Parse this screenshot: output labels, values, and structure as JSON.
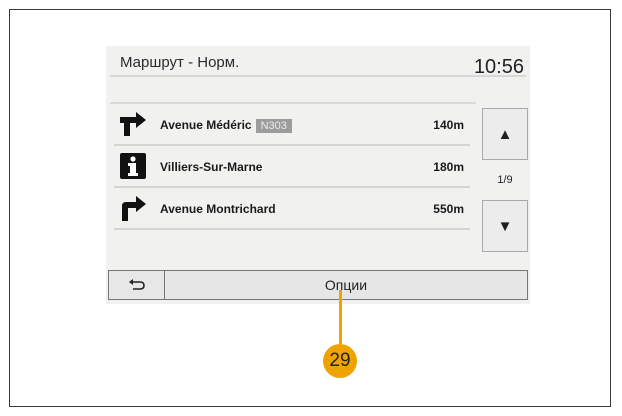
{
  "header": {
    "title": "Маршрут - Норм.",
    "clock": "10:56"
  },
  "route": [
    {
      "icon": "turn-right-icon",
      "street": "Avenue Médéric",
      "badge": "N303",
      "distance": "140m"
    },
    {
      "icon": "info-icon",
      "street": "Villiers-Sur-Marne",
      "distance": "180m"
    },
    {
      "icon": "turn-right-arrow-icon",
      "street": "Avenue Montrichard",
      "distance": "550m"
    }
  ],
  "pager": {
    "up_icon": "▲",
    "page": "1/9",
    "down_icon": "▼"
  },
  "bottom": {
    "options_label": "Опции",
    "back_icon": "back-icon"
  },
  "callout": {
    "number": "29"
  },
  "colors": {
    "accent": "#f0a300",
    "panel": "#f1f1f0"
  }
}
